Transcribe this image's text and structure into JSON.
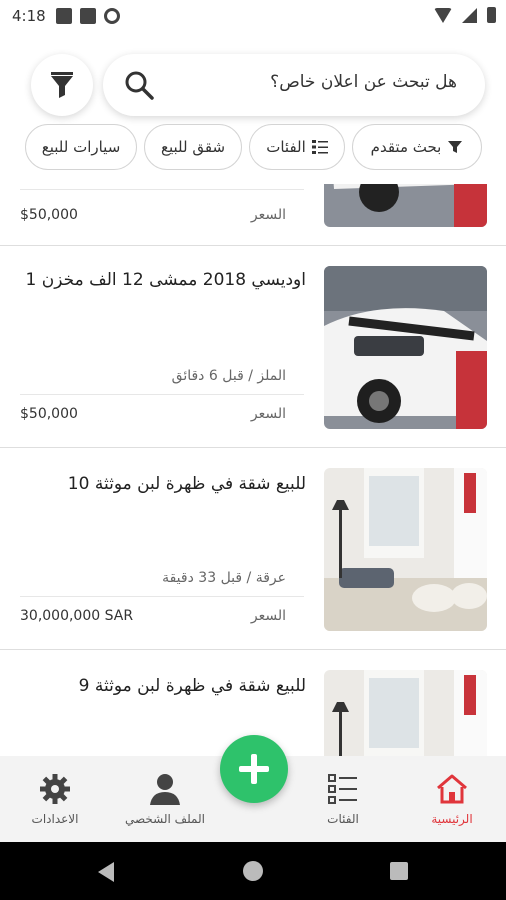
{
  "status_bar": {
    "time": "4:18"
  },
  "search": {
    "placeholder": "هل تبحث عن اعلان خاص؟"
  },
  "chips": [
    {
      "label": "بحث متقدم",
      "icon": "filter-icon"
    },
    {
      "label": "الفئات",
      "icon": "list-icon"
    },
    {
      "label": "شقق للبيع"
    },
    {
      "label": "سيارات للبيع"
    }
  ],
  "listings": [
    {
      "title": "",
      "meta": "",
      "price_label": "السعر",
      "price": "$50,000",
      "thumb": "car"
    },
    {
      "title": "اوديسي 2018 ممشى 12 الف مخزن 1",
      "meta": "الملز / قبل 6 دقائق",
      "price_label": "السعر",
      "price": "$50,000",
      "thumb": "car"
    },
    {
      "title": "للبيع شقة في ظهرة لبن موثثة 10",
      "meta": "عرقة / قبل 33 دقيقة",
      "price_label": "السعر",
      "price": "30,000,000 SAR",
      "thumb": "room"
    },
    {
      "title": "للبيع شقة في ظهرة لبن موثثة 9",
      "meta": "",
      "price_label": "",
      "price": "",
      "thumb": "room"
    }
  ],
  "bottom_nav": {
    "home": "الرئيسية",
    "categories": "الفئات",
    "profile": "الملف الشخصي",
    "settings": "الاعدادات"
  },
  "colors": {
    "accent": "#2ec26b",
    "active": "#e0353b"
  }
}
